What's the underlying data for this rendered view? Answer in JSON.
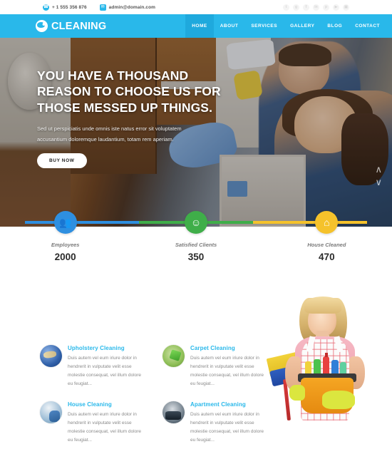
{
  "topbar": {
    "phone": "+ 1 555 356 876",
    "email": "admin@domain.com",
    "phone_icon": "phone-icon",
    "email_icon": "envelope-icon",
    "social": [
      {
        "name": "twitter",
        "glyph": "t"
      },
      {
        "name": "google-plus",
        "glyph": "g"
      },
      {
        "name": "facebook",
        "glyph": "f"
      },
      {
        "name": "linkedin",
        "glyph": "in"
      },
      {
        "name": "pinterest",
        "glyph": "p"
      },
      {
        "name": "youtube",
        "glyph": "▶"
      },
      {
        "name": "instagram",
        "glyph": "▣"
      }
    ]
  },
  "header": {
    "logo_text": "CLEANING",
    "brand_color": "#29b8ea",
    "nav": [
      {
        "label": "HOME",
        "active": true
      },
      {
        "label": "ABOUT",
        "active": false
      },
      {
        "label": "SERVICES",
        "active": false
      },
      {
        "label": "GALLERY",
        "active": false
      },
      {
        "label": "BLOG",
        "active": false
      },
      {
        "label": "CONTACT",
        "active": false
      }
    ]
  },
  "hero": {
    "title": "YOU HAVE A THOUSAND REASON TO CHOOSE US FOR THOSE MESSED UP THINGS.",
    "subtitle": "Sed ut perspiciatis unde omnis iste natus error sit voluptatem accusantium doloremque laudantium, totam rem aperiam.",
    "cta_label": "BUY NOW",
    "slider_prev": "‹",
    "slider_next": "›"
  },
  "counters": [
    {
      "label": "Employees",
      "value": "2000",
      "color": "#2e8fe0",
      "icon": "users-icon",
      "glyph": "👥"
    },
    {
      "label": "Satisfied Clients",
      "value": "350",
      "color": "#3fae49",
      "icon": "smiley-icon",
      "glyph": "☺"
    },
    {
      "label": "House Cleaned",
      "value": "470",
      "color": "#f5c22b",
      "icon": "home-icon",
      "glyph": "⌂"
    }
  ],
  "services": [
    {
      "title": "Upholstery Cleaning",
      "text": "Duis autem vel eum iriure dolor in hendrerit in vulputate velit esse molestie consequat, vel illum dolore eu feugiat...",
      "thumb": "upholstery-thumb"
    },
    {
      "title": "Carpet Cleaning",
      "text": "Duis autem vel eum iriure dolor in hendrerit in vulputate velit esse molestie consequat, vel illum dolore eu feugiat...",
      "thumb": "carpet-thumb"
    },
    {
      "title": "House Cleaning",
      "text": "Duis autem vel eum iriure dolor in hendrerit in vulputate velit esse molestie consequat, vel illum dolore eu feugiat...",
      "thumb": "house-thumb"
    },
    {
      "title": "Apartment Cleaning",
      "text": "Duis autem vel eum iriure dolor in hendrerit in vulputate velit esse molestie consequat, vel illum dolore eu feugiat...",
      "thumb": "apartment-thumb"
    }
  ]
}
